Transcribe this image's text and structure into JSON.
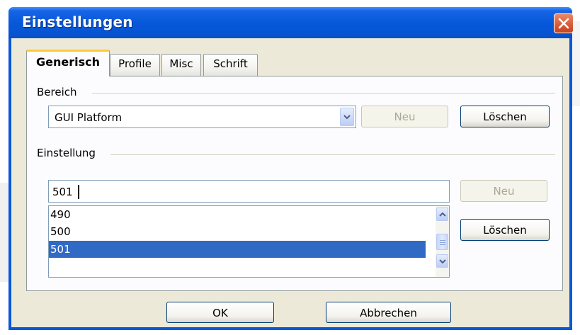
{
  "dialog": {
    "title": "Einstellungen",
    "close_icon": "close-icon"
  },
  "tabs": [
    {
      "label": "Generisch",
      "active": true
    },
    {
      "label": "Profile",
      "active": false
    },
    {
      "label": "Misc",
      "active": false
    },
    {
      "label": "Schrift",
      "active": false
    }
  ],
  "bereich": {
    "label": "Bereich",
    "selected": "GUI Platform",
    "new_label": "Neu",
    "delete_label": "Löschen"
  },
  "einstellung": {
    "label": "Einstellung",
    "value": "501",
    "items": [
      "490",
      "500",
      "501"
    ],
    "selected_item": "501",
    "new_label": "Neu",
    "delete_label": "Löschen"
  },
  "footer": {
    "ok_label": "OK",
    "cancel_label": "Abbrechen"
  },
  "colors": {
    "titlebar": "#0758da",
    "selection": "#316ac5",
    "active_tab_accent": "#ffc83c",
    "close_button": "#d65a36"
  }
}
